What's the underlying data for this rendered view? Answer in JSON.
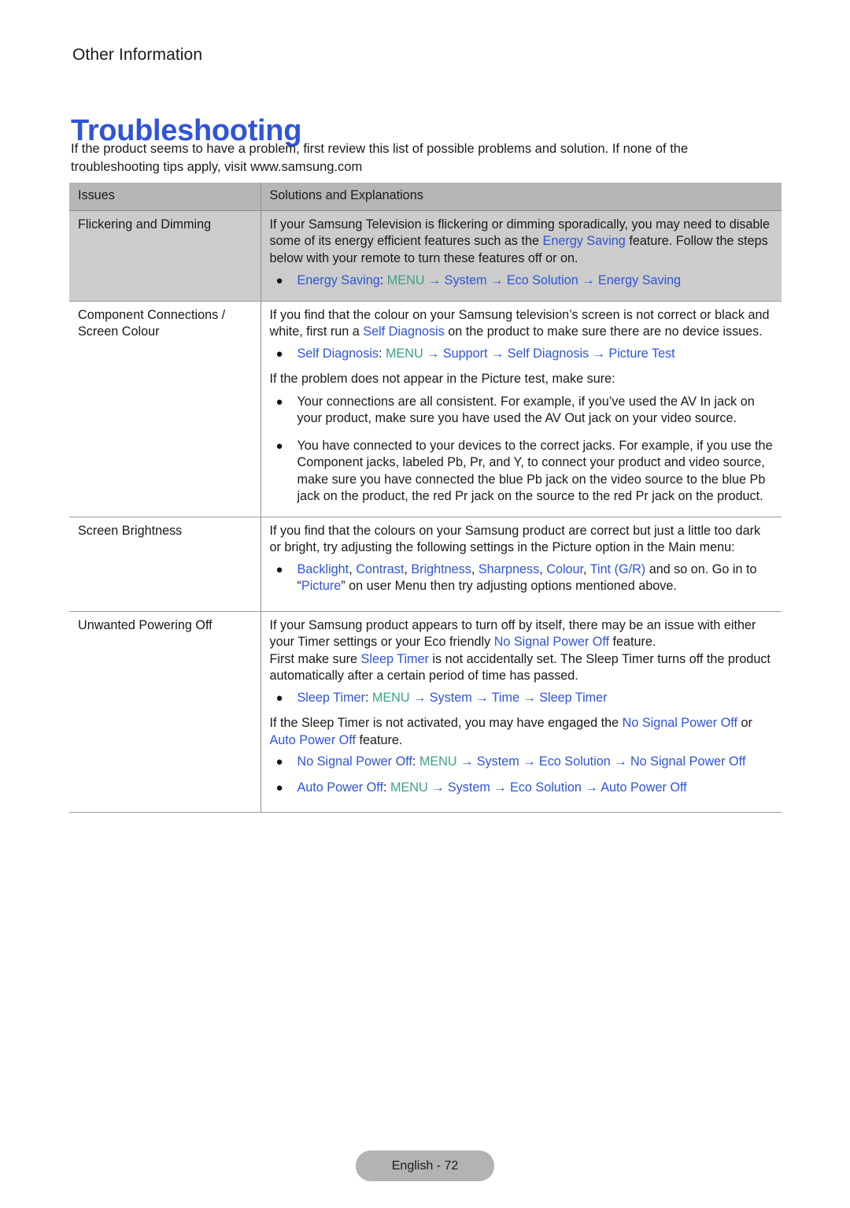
{
  "header": {
    "section_label": "Other Information",
    "title": "Troubleshooting"
  },
  "intro": "If the product seems to have a problem, first review this list of possible problems and solution. If none of the troubleshooting tips apply, visit www.samsung.com",
  "table": {
    "columns": [
      "Issues",
      "Solutions and Explanations"
    ],
    "rows": [
      {
        "issue": "Flickering and Dimming",
        "paragraphs": [
          "If your Samsung Television is flickering or dimming sporadically, you may need to disable some of its energy efficient features such as the Energy Saving feature. Follow the steps below with your remote to turn these features off or on."
        ],
        "path_bullets": [
          {
            "term": "Energy Saving",
            "colon": ":",
            "menu": "MENU",
            "steps": [
              "System",
              "Eco Solution",
              "Energy Saving"
            ]
          }
        ]
      },
      {
        "issue": "Component Connections / Screen Colour",
        "paragraphs": [
          "If you find that the colour on your Samsung television’s screen is not correct or black and white, first run a Self Diagnosis on the product to make sure there are no device issues."
        ],
        "path_bullets": [
          {
            "term": "Self Diagnosis",
            "colon": ":",
            "menu": "MENU",
            "steps": [
              "Support",
              "Self Diagnosis",
              "Picture Test"
            ]
          }
        ],
        "after_text": "If the problem does not appear in the Picture test, make sure:",
        "text_bullets": [
          "Your connections are all consistent. For example, if you’ve used the AV In jack on your product, make sure you have used the AV Out jack on your video source.",
          "You have connected to your devices to the correct jacks. For example, if you use the Component jacks, labeled Pb, Pr, and Y, to connect your product and video source, make sure you have connected the blue Pb jack on the video source to the blue Pb jack on the product, the red Pr jack on the source to the red Pr jack on the product."
        ]
      },
      {
        "issue": "Screen Brightness",
        "paragraphs": [
          "If you find that the colours on your Samsung product are correct but just a little too dark or bright, try adjusting the following settings in the Picture option in the Main menu:"
        ],
        "settings_bullet": {
          "terms": [
            "Backlight",
            "Contrast",
            "Brightness",
            "Sharpness",
            "Colour",
            "Tint (G/R)"
          ],
          "tail": " and so on. Go in to ",
          "quote_open": "“",
          "quoted_term": "Picture",
          "quote_close": "”",
          "tail2": " on user Menu then try adjusting options mentioned above."
        }
      },
      {
        "issue": "Unwanted Powering Off",
        "paragraphs": [
          "If your Samsung product appears to turn off by itself, there may be an issue with either your Timer settings or your Eco friendly No Signal Power Off feature.",
          "First make sure Sleep Timer is not accidentally set. The Sleep Timer turns off the product automatically after a certain period of time has passed."
        ],
        "path_bullets": [
          {
            "term": "Sleep Timer",
            "colon": ":",
            "menu": "MENU",
            "steps": [
              "System",
              "Time",
              "Sleep Timer"
            ]
          }
        ],
        "after_text": "If the Sleep Timer is not activated, you may have engaged the No Signal Power Off or Auto Power Off feature.",
        "path_bullets_2": [
          {
            "term": "No Signal Power Off",
            "colon": ":",
            "menu": "MENU",
            "steps": [
              "System",
              "Eco Solution",
              "No Signal Power Off"
            ]
          },
          {
            "term": "Auto Power Off",
            "colon": ":",
            "menu": "MENU",
            "steps": [
              "System",
              "Eco Solution",
              "Auto Power Off"
            ]
          }
        ]
      }
    ]
  },
  "footer": {
    "page_label": "English - 72"
  },
  "colors": {
    "link_blue": "#2f54d8",
    "menu_teal": "#3aa08a",
    "header_grey": "#b6b6b6",
    "row_grey": "#cccccc",
    "footer_grey": "#b3b3b3"
  },
  "inline_links": {
    "energy_saving": "Energy Saving",
    "self_diagnosis": "Self Diagnosis",
    "no_signal_power_off": "No Signal Power Off",
    "auto_power_off": "Auto Power Off",
    "sleep_timer": "Sleep Timer",
    "bullet_glyph": "●",
    "arrow_glyph": "→"
  }
}
